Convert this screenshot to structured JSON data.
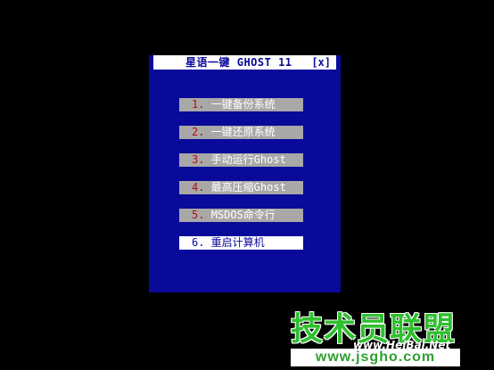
{
  "window": {
    "title": "星语一键 GHOST 11",
    "close_label": "[x]"
  },
  "menu": {
    "items": [
      {
        "num": "1.",
        "label": " 一键备份系统"
      },
      {
        "num": "2.",
        "label": " 一键还原系统"
      },
      {
        "num": "3.",
        "label": " 手动运行Ghost"
      },
      {
        "num": "4.",
        "label": " 最高压缩Ghost"
      },
      {
        "num": "5.",
        "label": " MSDOS命令行"
      },
      {
        "num": "6.",
        "label": " 重启计算机"
      }
    ],
    "selected_index": 5
  },
  "watermark": {
    "top": "技术员联盟",
    "middle": "www.HeiBai.Net",
    "bottom": "www.jsgho.com"
  },
  "colors": {
    "background": "#000000",
    "window": "#0a0a9a",
    "menu_item": "#a8a8a8",
    "menu_selected": "#ffffff",
    "number": "#b01010"
  }
}
